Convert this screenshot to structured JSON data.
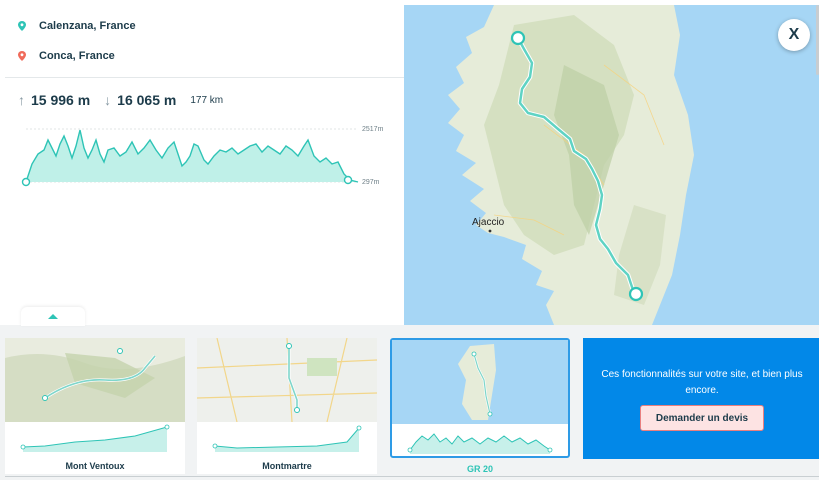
{
  "route": {
    "start": "Calenzana, France",
    "end": "Conca, France",
    "ascent": "15 996 m",
    "descent": "16 065 m",
    "distance": "177 km",
    "max_elevation": "2517m",
    "min_elevation": "297m"
  },
  "map": {
    "city_label": "Ajaccio",
    "close_label": "X"
  },
  "cards": [
    {
      "label": "Mont Ventoux"
    },
    {
      "label": "Montmartre"
    },
    {
      "label": "GR 20"
    }
  ],
  "promo": {
    "text": "Ces fonctionnalités sur votre site, et bien plus encore.",
    "button": "Demander un devis"
  },
  "colors": {
    "accent": "#2ec4b6",
    "start_pin": "#2ec4b6",
    "end_pin": "#f06a5a",
    "promo_bg": "#0288e8",
    "selected_border": "#2e9be6"
  }
}
